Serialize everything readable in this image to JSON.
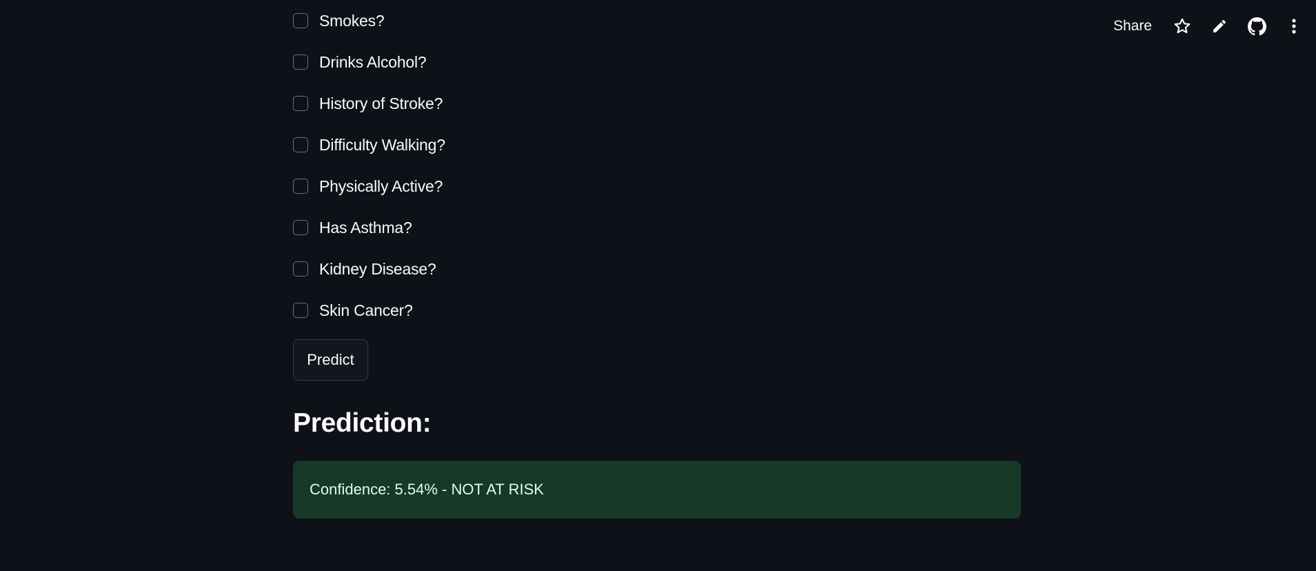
{
  "toolbar": {
    "share_label": "Share",
    "icons": [
      "star-icon",
      "pencil-icon",
      "github-icon",
      "more-vertical-icon"
    ]
  },
  "form": {
    "checkboxes": [
      {
        "label": "Smokes?",
        "checked": false
      },
      {
        "label": "Drinks Alcohol?",
        "checked": false
      },
      {
        "label": "History of Stroke?",
        "checked": false
      },
      {
        "label": "Difficulty Walking?",
        "checked": false
      },
      {
        "label": "Physically Active?",
        "checked": false
      },
      {
        "label": "Has Asthma?",
        "checked": false
      },
      {
        "label": "Kidney Disease?",
        "checked": false
      },
      {
        "label": "Skin Cancer?",
        "checked": false
      }
    ],
    "predict_label": "Predict"
  },
  "result": {
    "heading": "Prediction:",
    "message": "Confidence: 5.54% - NOT AT RISK",
    "status_color": "#173928"
  },
  "colors": {
    "background": "#0e1117",
    "text": "#fafafa",
    "success_bg": "#173928",
    "success_text": "#dffde9"
  }
}
